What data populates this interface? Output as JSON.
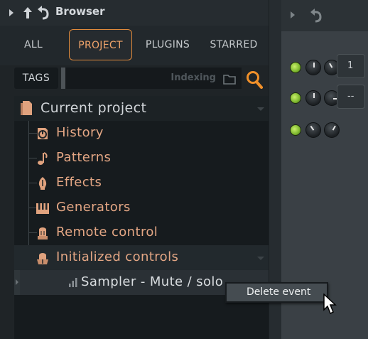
{
  "browser": {
    "title": "Browser",
    "tabs": [
      "ALL",
      "PROJECT",
      "PLUGINS",
      "STARRED"
    ],
    "active_tab": "PROJECT",
    "tags_label": "TAGS",
    "search_status": "Indexing",
    "tree": {
      "root": "Current project",
      "items": [
        "History",
        "Patterns",
        "Effects",
        "Generators",
        "Remote control",
        "Initialized controls"
      ],
      "child": "Sampler - Mute / solo"
    }
  },
  "context_menu": {
    "items": [
      "Delete event"
    ]
  },
  "right_panel": {
    "slot_values": [
      "1",
      "--"
    ]
  },
  "colors": {
    "accent": "#e08a3c",
    "tree_text": "#e3a684",
    "led_on": "#8fd13a"
  },
  "icons": [
    "triangle-right-icon",
    "arrow-up-icon",
    "undo-icon",
    "folder-icon",
    "search-icon",
    "document-icon",
    "history-icon",
    "note-icon",
    "effects-icon",
    "piano-icon",
    "remote-icon",
    "init-knob-icon",
    "bar-chart-icon",
    "mouse-cursor-icon"
  ]
}
